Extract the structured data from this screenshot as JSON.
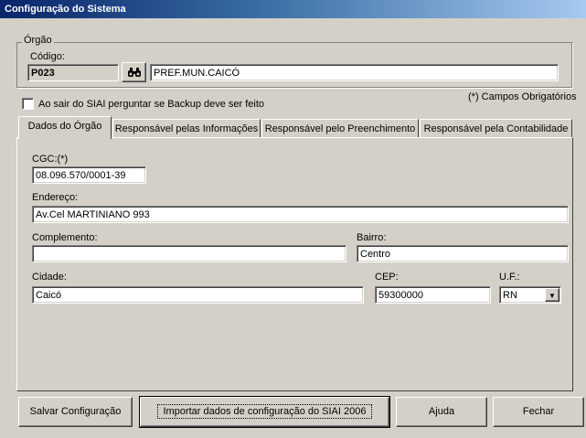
{
  "window": {
    "title": "Configuração do Sistema"
  },
  "orgao": {
    "legend": "Órgão",
    "codigo_label": "Código:",
    "codigo_value": "P023",
    "nome_value": "PREF.MUN.CAICÓ"
  },
  "backup_checkbox": {
    "label": "Ao sair do SIAI perguntar se Backup deve ser feito",
    "checked": false
  },
  "required_note": "(*) Campos Obrigatórios",
  "tabs": [
    {
      "label": "Dados do Órgão",
      "active": true
    },
    {
      "label": "Responsável pelas Informações",
      "active": false
    },
    {
      "label": "Responsável pelo Preenchimento",
      "active": false
    },
    {
      "label": "Responsável pela Contabilidade",
      "active": false
    }
  ],
  "form": {
    "cgc_label": "CGC:(*)",
    "cgc_value": "08.096.570/0001-39",
    "endereco_label": "Endereço:",
    "endereco_value": "Av.Cel MARTINIANO 993",
    "complemento_label": "Complemento:",
    "complemento_value": "",
    "bairro_label": "Bairro:",
    "bairro_value": "Centro",
    "cidade_label": "Cidade:",
    "cidade_value": "Caicó",
    "cep_label": "CEP:",
    "cep_value": "59300000",
    "uf_label": "U.F.:",
    "uf_value": "RN"
  },
  "buttons": {
    "salvar": "Salvar Configuração",
    "importar": "Importar dados de configuração do SIAI 2006",
    "ajuda": "Ajuda",
    "fechar": "Fechar"
  },
  "icons": {
    "search": "binoculars-icon",
    "dropdown": "chevron-down-icon"
  }
}
